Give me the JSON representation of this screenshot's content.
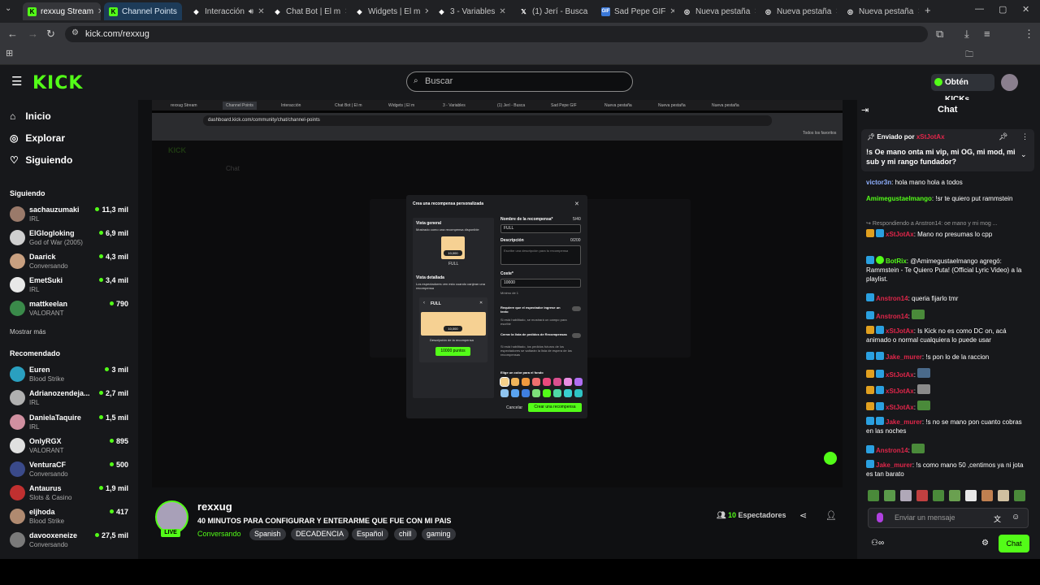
{
  "browser": {
    "tabs": [
      {
        "label": "rexxug Stream",
        "favicon": "kick"
      },
      {
        "label": "Channel Points",
        "favicon": "kick"
      },
      {
        "label": "Interacción",
        "favicon": "generic"
      },
      {
        "label": "Chat Bot | El m",
        "favicon": "generic"
      },
      {
        "label": "Widgets | El m",
        "favicon": "generic"
      },
      {
        "label": "3 - Variables",
        "favicon": "generic"
      },
      {
        "label": "(1) Jerí - Busca",
        "favicon": "x"
      },
      {
        "label": "Sad Pepe GIF",
        "favicon": "gif"
      },
      {
        "label": "Nueva pestaña",
        "favicon": "chrome"
      },
      {
        "label": "Nueva pestaña",
        "favicon": "chrome"
      },
      {
        "label": "Nueva pestaña",
        "favicon": "chrome"
      }
    ],
    "url": "kick.com/rexxug",
    "bookmarks_all": "Todos los favoritos",
    "profile_initial": "J"
  },
  "header": {
    "logo": "KICK",
    "search_placeholder": "Buscar",
    "kicks_button": "Obtén KICKs"
  },
  "sidebar": {
    "nav": [
      {
        "label": "Inicio",
        "icon": "home-icon"
      },
      {
        "label": "Explorar",
        "icon": "compass-icon"
      },
      {
        "label": "Siguiendo",
        "icon": "heart-icon"
      }
    ],
    "following_title": "Siguiendo",
    "following": [
      {
        "name": "sachauzumaki",
        "category": "IRL",
        "viewers": "11,3 mil"
      },
      {
        "name": "ElGlogloking",
        "category": "God of War (2005)",
        "viewers": "6,9 mil"
      },
      {
        "name": "Daarick",
        "category": "Conversando",
        "viewers": "4,3 mil"
      },
      {
        "name": "EmetSuki",
        "category": "IRL",
        "viewers": "3,4 mil"
      },
      {
        "name": "mattkeelan",
        "category": "VALORANT",
        "viewers": "790"
      }
    ],
    "show_more": "Mostrar más",
    "recommended_title": "Recomendado",
    "recommended": [
      {
        "name": "Euren",
        "category": "Blood Strike",
        "viewers": "3 mil"
      },
      {
        "name": "Adrianozendeja...",
        "category": "IRL",
        "viewers": "2,7 mil"
      },
      {
        "name": "DanielaTaquire",
        "category": "IRL",
        "viewers": "1,5 mil"
      },
      {
        "name": "OnlyRGX",
        "category": "VALORANT",
        "viewers": "895"
      },
      {
        "name": "VenturaCF",
        "category": "Conversando",
        "viewers": "500"
      },
      {
        "name": "Antaurus",
        "category": "Slots & Casino",
        "viewers": "1,9 mil"
      },
      {
        "name": "eljhoda",
        "category": "Blood Strike",
        "viewers": "417"
      },
      {
        "name": "davooxeneize",
        "category": "Conversando",
        "viewers": "27,5 mil"
      }
    ]
  },
  "video": {
    "inner_url": "dashboard.kick.com/community/chat/channel-points",
    "modal": {
      "title": "Crea una recompensa personalizada",
      "general_view": "Vista general",
      "general_view_desc": "Mostrado como una recompensa disponible",
      "reward_preview_name": "FULL",
      "reward_cost": "10,000",
      "detailed_view": "Vista detallada",
      "detailed_view_desc": "Los espectadores ven esto cuando canjean una recompensa",
      "detail_desc": "Descripción de la recompensa",
      "detail_points": "10000 puntos",
      "name_label": "Nombre de la recompensa*",
      "name_count": "5/40",
      "name_value": "FULL",
      "desc_label": "Descripción",
      "desc_count": "0/200",
      "desc_placeholder": "Escribe una descripción para tu recompensa",
      "cost_label": "Coste*",
      "cost_value": "10000",
      "cost_min": "Mínimo de 1",
      "require_text_label": "Requiere que el espectador ingrese un texto",
      "require_text_desc": "Si está habilitado, se mostrará un campo para escribir",
      "close_list_label": "Cerrar la lista de pedidos de Recompensas",
      "close_list_desc": "Si está habilitado, los pedidos futuros de los espectadores se saltarán la lista de espera de las recompensas",
      "color_label": "Elige un color para el fondo",
      "colors": [
        "#f5d08a",
        "#f0b45a",
        "#f19a3e",
        "#ef6f6f",
        "#e94a7d",
        "#d94f8f",
        "#e98ee3",
        "#b06ef2",
        "#8fc4f0",
        "#5aa3f0",
        "#3f7fe0",
        "#7ee07a",
        "#53fc18",
        "#4fd9a8",
        "#39d0d0",
        "#2ec4c4"
      ],
      "cancel": "Cancelar",
      "create": "Crear una recompensa"
    }
  },
  "stream": {
    "channel": "rexxug",
    "live": "LIVE",
    "title": "40 MINUTOS PARA CONFIGURAR Y ENTERARME QUE FUE CON MI PAIS",
    "category": "Conversando",
    "tags": [
      "Spanish",
      "DECADENCIA",
      "Español",
      "chill",
      "gaming"
    ],
    "viewers_count": "10",
    "viewers_label": "Espectadores"
  },
  "chat": {
    "title": "Chat",
    "pinned_by_label": "Enviado por",
    "pinned_by_user": "xStJotAx",
    "pinned_text": "!s Oe mano onta mi vip, mi OG, mi mod, mi sub y mi rango fundador?",
    "messages": [
      {
        "user": "victor3n",
        "color": "#8fb0ff",
        "text": ": hola mano hola a todos"
      },
      {
        "user": "Amimegustaelmango",
        "color": "#53fc18",
        "text": ": !sr te quiero put rammstein"
      },
      {
        "reply": "Respondiendo a Anstron14: oe mano y mi mog ..."
      },
      {
        "user": "xStJotAx",
        "color": "#e0264a",
        "text": ": Mano no presumas lo cpp"
      },
      {
        "user": "BotRix",
        "color": "#53fc18",
        "text": ": @Amimegustaelmango agregó: Rammstein - Te Quiero Puta! (Official Lyric Video) a la playlist."
      },
      {
        "user": "Anstron14",
        "color": "#e0264a",
        "text": ": queria fijarlo tmr"
      },
      {
        "user": "Anstron14",
        "color": "#e0264a",
        "text": ":"
      },
      {
        "user": "xStJotAx",
        "color": "#e0264a",
        "text": ": Is Kick no es como DC on, acá animado o normal cualquiera lo puede usar"
      },
      {
        "user": "Jake_murer",
        "color": "#e0264a",
        "text": ": !s pon lo de la raccion"
      },
      {
        "user": "xStJotAx",
        "color": "#e0264a",
        "text": ":"
      },
      {
        "user": "xStJotAx",
        "color": "#e0264a",
        "text": ":"
      },
      {
        "user": "xStJotAx",
        "color": "#e0264a",
        "text": ":"
      },
      {
        "user": "Jake_murer",
        "color": "#e0264a",
        "text": ": !s no se mano pon cuanto cobras en las noches"
      },
      {
        "user": "Anstron14",
        "color": "#e0264a",
        "text": ":"
      },
      {
        "user": "Jake_murer",
        "color": "#e0264a",
        "text": ": !s como mano 50 ,centimos ya ni jota es tan barato"
      }
    ],
    "input_placeholder": "Enviar un mensaje",
    "send_button": "Chat"
  },
  "colors": {
    "accent": "#53fc18",
    "bg": "#0f1012",
    "panel": "#17181b"
  }
}
